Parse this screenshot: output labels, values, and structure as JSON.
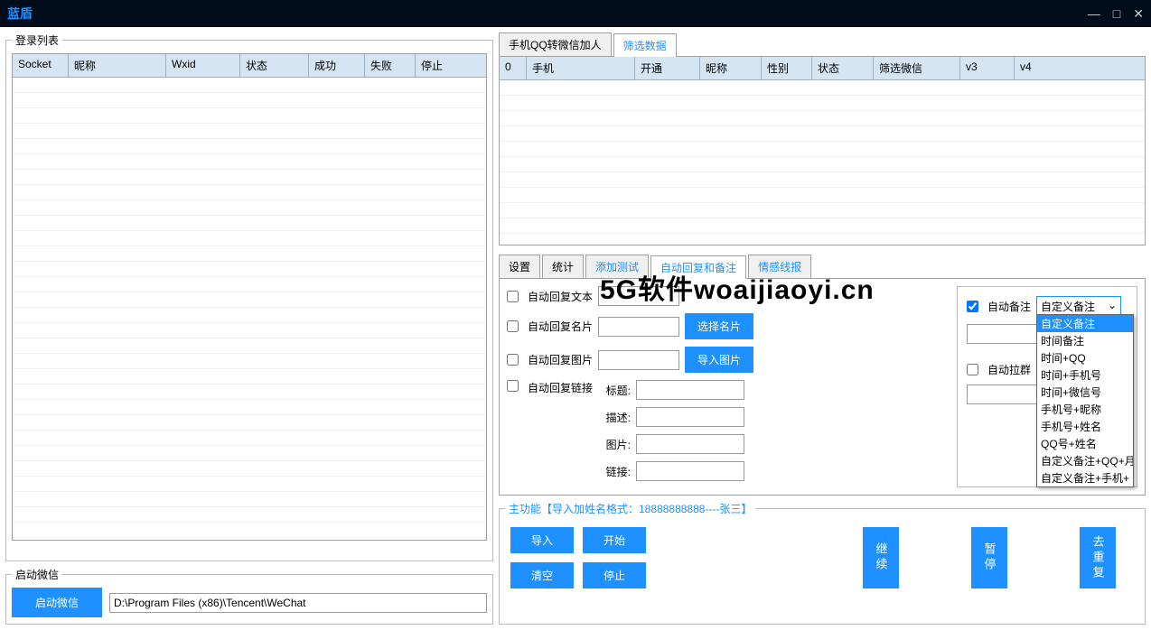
{
  "title": "蓝盾",
  "login_list": {
    "legend": "登录列表",
    "columns": [
      "Socket",
      "昵称",
      "Wxid",
      "状态",
      "成功",
      "失败",
      "停止"
    ]
  },
  "start_wechat": {
    "legend": "启动微信",
    "button": "启动微信",
    "path": "D:\\Program Files (x86)\\Tencent\\WeChat"
  },
  "top_tabs": [
    "手机QQ转微信加人",
    "筛选数据"
  ],
  "top_table": {
    "columns": [
      "0",
      "手机",
      "开通",
      "昵称",
      "性别",
      "状态",
      "筛选微信",
      "v3",
      "v4"
    ]
  },
  "mid_tabs": [
    "设置",
    "统计",
    "添加测试",
    "自动回复和备注",
    "情感线报"
  ],
  "auto_reply": {
    "text": "自动回复文本",
    "card": "自动回复名片",
    "card_btn": "选择名片",
    "image": "自动回复图片",
    "image_btn": "导入图片",
    "link": "自动回复链接",
    "title_lbl": "标题:",
    "desc_lbl": "描述:",
    "pic_lbl": "图片:",
    "link_lbl": "链接:"
  },
  "auto_remark": {
    "label": "自动备注",
    "selected": "自定义备注",
    "options": [
      "自定义备注",
      "时间备注",
      "时间+QQ",
      "时间+手机号",
      "时间+微信号",
      "手机号+昵称",
      "手机号+姓名",
      "QQ号+姓名",
      "自定义备注+QQ+月",
      "自定义备注+手机+"
    ]
  },
  "auto_pull": {
    "label": "自动拉群"
  },
  "main_func": {
    "legend": "主功能【导入加姓名格式：18888888888----张三】",
    "import": "导入",
    "start": "开始",
    "clear": "清空",
    "stop": "停止",
    "continue": "继续",
    "pause": "暂停",
    "dedup": "去重复"
  },
  "watermark": "5G软件woaijiaoyi.cn"
}
